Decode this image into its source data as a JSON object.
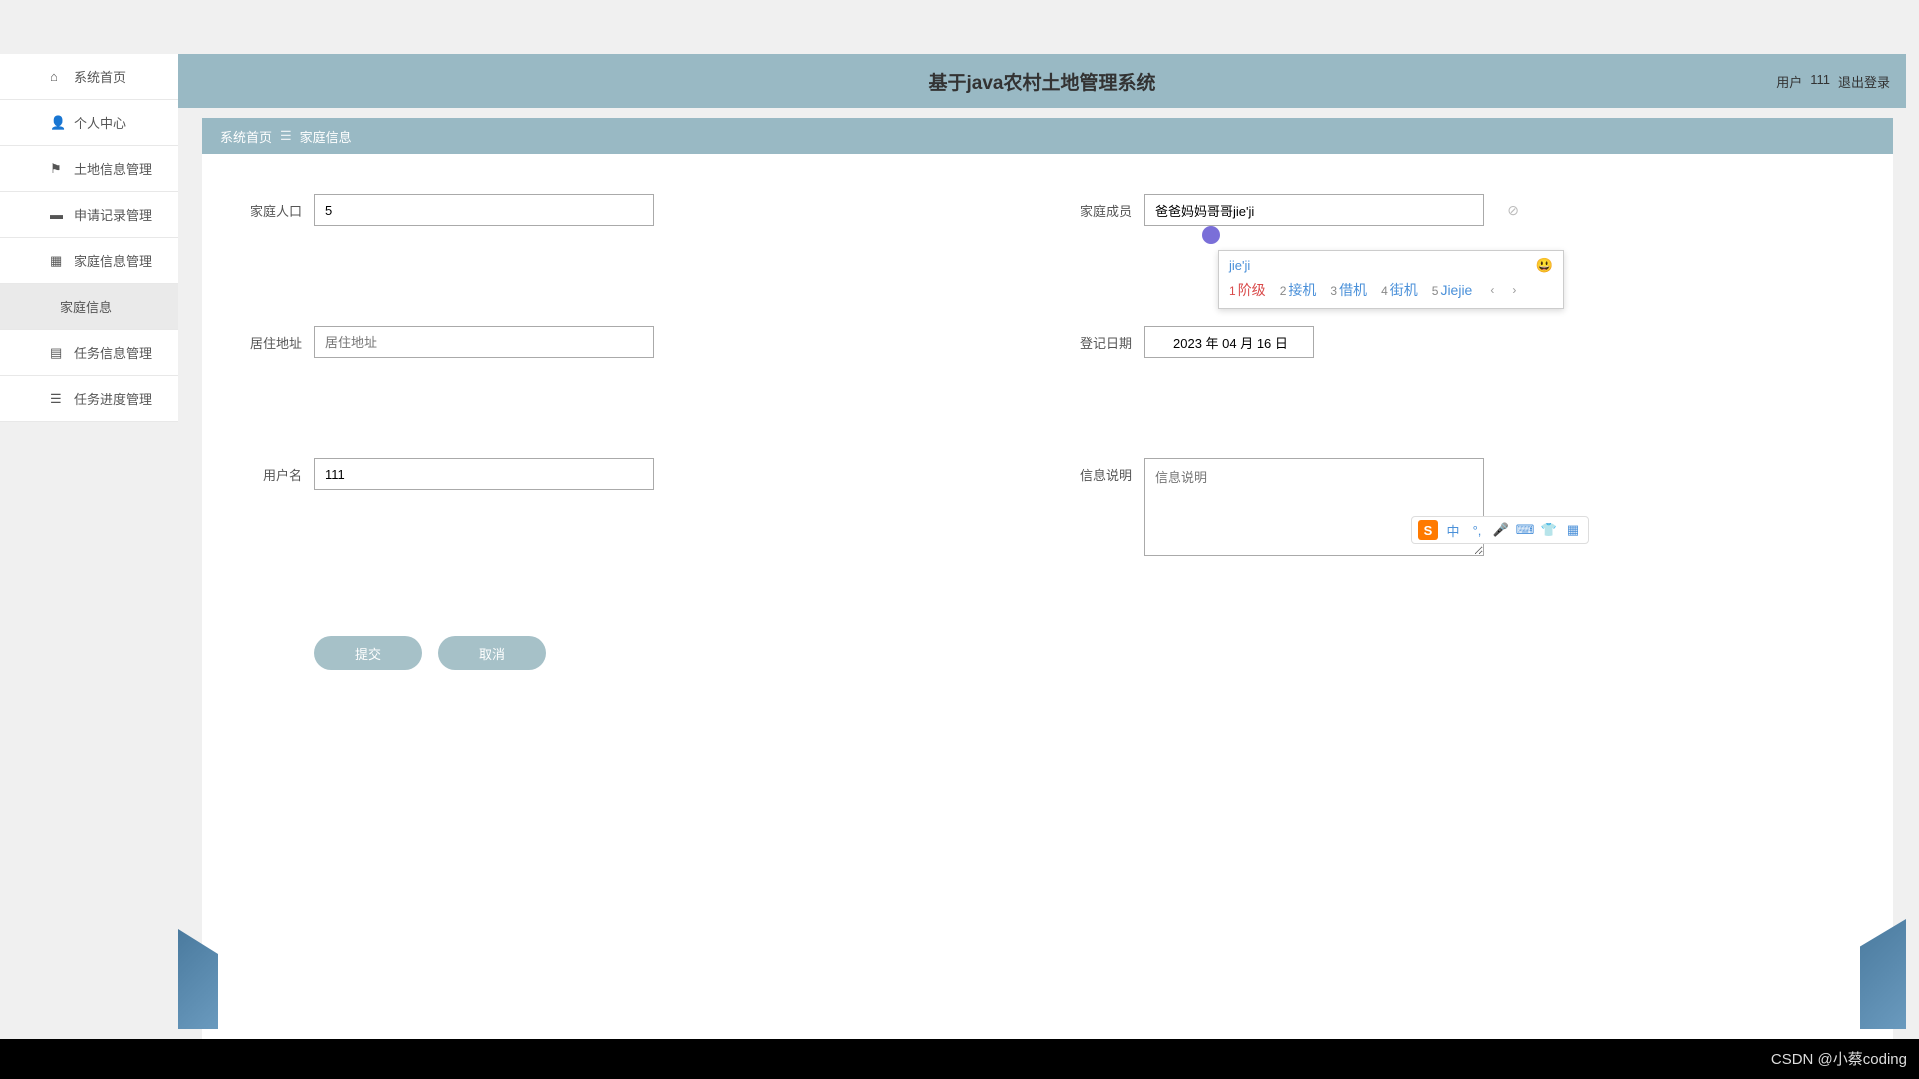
{
  "header": {
    "title": "基于java农村土地管理系统",
    "user_label": "用户",
    "user_name": "111",
    "logout": "退出登录"
  },
  "sidebar": {
    "items": [
      {
        "icon": "home",
        "label": "系统首页"
      },
      {
        "icon": "user",
        "label": "个人中心"
      },
      {
        "icon": "flag",
        "label": "土地信息管理"
      },
      {
        "icon": "briefcase",
        "label": "申请记录管理"
      },
      {
        "icon": "grid",
        "label": "家庭信息管理"
      },
      {
        "icon": "",
        "label": "家庭信息",
        "active": true,
        "sub": true
      },
      {
        "icon": "grid2",
        "label": "任务信息管理"
      },
      {
        "icon": "list",
        "label": "任务进度管理"
      }
    ]
  },
  "breadcrumb": {
    "home": "系统首页",
    "current": "家庭信息"
  },
  "form": {
    "population_label": "家庭人口",
    "population_value": "5",
    "members_label": "家庭成员",
    "members_value": "爸爸妈妈哥哥jie'ji",
    "address_label": "居住地址",
    "address_placeholder": "居住地址",
    "address_value": "",
    "date_label": "登记日期",
    "date_value": "2023 年 04 月 16 日",
    "username_label": "用户名",
    "username_value": "111",
    "info_label": "信息说明",
    "info_placeholder": "信息说明",
    "info_value": ""
  },
  "actions": {
    "submit": "提交",
    "cancel": "取消"
  },
  "ime": {
    "typed": "jie'ji",
    "emoji": "😃",
    "candidates": [
      {
        "num": "1",
        "text": "阶级"
      },
      {
        "num": "2",
        "text": "接机"
      },
      {
        "num": "3",
        "text": "借机"
      },
      {
        "num": "4",
        "text": "街机"
      },
      {
        "num": "5",
        "text": "Jiejie"
      }
    ],
    "toolbar": {
      "logo": "S",
      "lang": "中"
    }
  },
  "watermark": "CSDN @小蔡coding"
}
